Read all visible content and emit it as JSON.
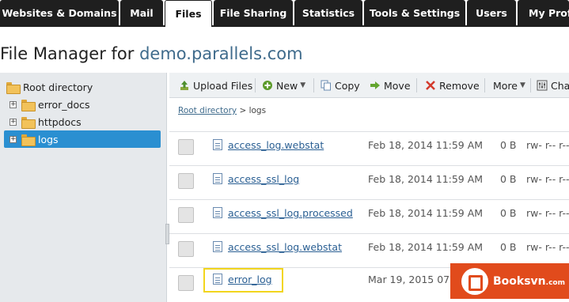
{
  "tabs": [
    {
      "label": "Websites & Domains"
    },
    {
      "label": "Mail"
    },
    {
      "label": "Files"
    },
    {
      "label": "File Sharing"
    },
    {
      "label": "Statistics"
    },
    {
      "label": "Tools & Settings"
    },
    {
      "label": "Users"
    },
    {
      "label": "My Profi"
    }
  ],
  "active_tab": "Files",
  "header": {
    "title_prefix": "File Manager for ",
    "domain": "demo.parallels.com"
  },
  "sidebar": {
    "root_label": "Root directory",
    "items": [
      {
        "label": "error_docs",
        "icon": "folder-icon"
      },
      {
        "label": "httpdocs",
        "icon": "folder-icon"
      },
      {
        "label": "logs",
        "icon": "folder-icon",
        "selected": true
      }
    ]
  },
  "toolbar": {
    "upload": "Upload Files",
    "new": "New",
    "copy": "Copy",
    "move": "Move",
    "remove": "Remove",
    "more": "More",
    "change": "Cha"
  },
  "breadcrumb": {
    "root": "Root directory",
    "sep": " > ",
    "current": "logs"
  },
  "files": [
    {
      "name": "access_log.webstat",
      "date": "Feb 18, 2014 11:59 AM",
      "size": "0 B",
      "perms": "rw- r-- r--"
    },
    {
      "name": "access_ssl_log",
      "date": "Feb 18, 2014 11:59 AM",
      "size": "0 B",
      "perms": "rw- r-- r--"
    },
    {
      "name": "access_ssl_log.processed",
      "date": "Feb 18, 2014 11:59 AM",
      "size": "0 B",
      "perms": "rw- r-- r--"
    },
    {
      "name": "access_ssl_log.webstat",
      "date": "Feb 18, 2014 11:59 AM",
      "size": "0 B",
      "perms": "rw- r-- r--"
    },
    {
      "name": "error_log",
      "date": "Mar 19, 2015 07:2",
      "size": "",
      "perms": ""
    }
  ],
  "watermark": {
    "text": "Booksvn",
    "suffix": ".com"
  },
  "colors": {
    "accent": "#2a8fd1",
    "tab_bg": "#1f1f1f",
    "link": "#2a5f93",
    "highlight": "#f2d51d",
    "watermark": "#e14b1c"
  }
}
